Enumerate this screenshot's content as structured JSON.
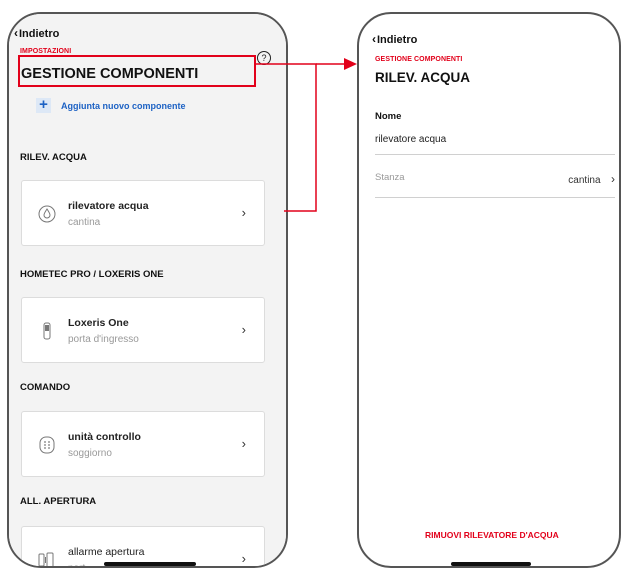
{
  "left_screen": {
    "back_label": "Indietro",
    "breadcrumb": "IMPOSTAZIONI",
    "title": "GESTIONE COMPONENTI",
    "help_icon": "?",
    "add_label": "Aggiunta nuovo componente",
    "sections": [
      {
        "title": "RILEV. ACQUA",
        "device_name": "rilevatore acqua",
        "device_room": "cantina",
        "icon": "water-drop-icon"
      },
      {
        "title": "HOMETEC PRO / LOXERIS ONE",
        "device_name": "Loxeris One",
        "device_room": "porta d'ingresso",
        "icon": "door-lock-icon"
      },
      {
        "title": "COMANDO",
        "device_name": "unità controllo",
        "device_room": "soggiorno",
        "icon": "keypad-icon"
      },
      {
        "title": "ALL. APERTURA",
        "device_name": "allarme apertura",
        "device_room": "port",
        "icon": "door-sensor-icon"
      }
    ]
  },
  "right_screen": {
    "back_label": "Indietro",
    "breadcrumb": "GESTIONE COMPONENTI",
    "title": "RILEV. ACQUA",
    "name_label": "Nome",
    "name_value": "rilevatore acqua",
    "room_label": "Stanza",
    "room_value": "cantina",
    "remove_label": "RIMUOVI RILEVATORE D'ACQUA"
  },
  "colors": {
    "accent_red": "#e2001a",
    "link_blue": "#1d62c4"
  }
}
